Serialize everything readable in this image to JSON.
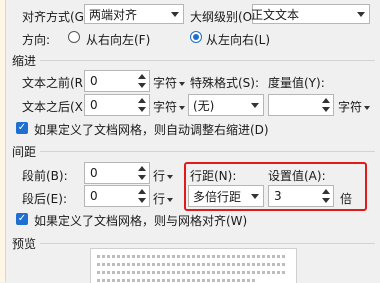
{
  "general": {
    "alignment_label": "对齐方式(G):",
    "alignment_value": "两端对齐",
    "outline_label": "大纲级别(O):",
    "outline_value": "正文文本",
    "direction_label": "方向:",
    "rtl_label": "从右向左(F)",
    "ltr_label": "从左向右(L)"
  },
  "indent": {
    "section_title": "缩进",
    "before_label": "文本之前(R):",
    "before_value": "0",
    "before_unit": "字符",
    "after_label": "文本之后(X):",
    "after_value": "0",
    "after_unit": "字符",
    "special_label": "特殊格式(S):",
    "special_value": "(无)",
    "measure_label": "度量值(Y):",
    "measure_value": "",
    "measure_unit": "字符",
    "grid_checkbox_label": "如果定义了文档网格，则自动调整右缩进(D)"
  },
  "spacing": {
    "section_title": "间距",
    "before_label": "段前(B):",
    "before_value": "0",
    "before_unit": "行",
    "after_label": "段后(E):",
    "after_value": "0",
    "after_unit": "行",
    "line_spacing_label": "行距(N):",
    "line_spacing_value": "多倍行距",
    "setting_label": "设置值(A):",
    "setting_value": "3",
    "setting_unit": "倍",
    "grid_checkbox_label": "如果定义了文档网格，则与网格对齐(W)"
  },
  "preview": {
    "section_title": "预览"
  },
  "colors": {
    "accent": "#1e6fd0",
    "highlight": "#e11b1b"
  }
}
